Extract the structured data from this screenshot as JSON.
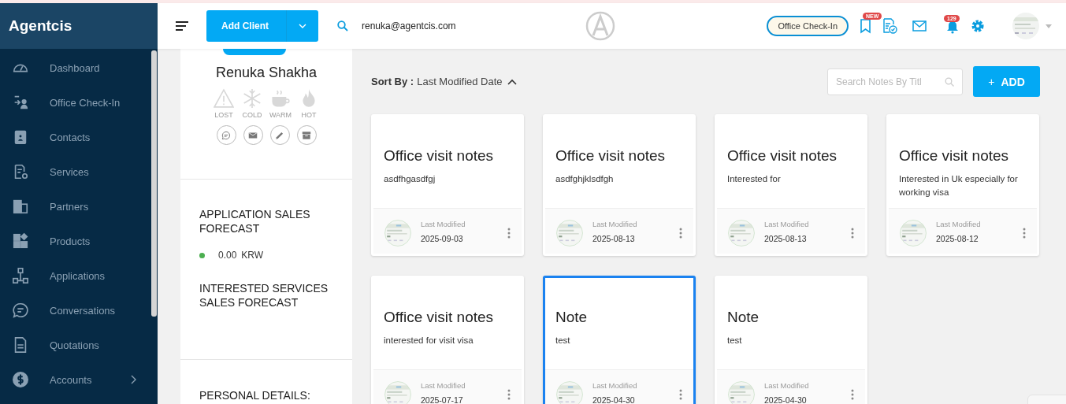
{
  "brand": "Agentcis",
  "sidebar": {
    "items": [
      {
        "label": "Dashboard",
        "kind": "gauge",
        "has_children": false
      },
      {
        "label": "Office Check-In",
        "kind": "checkin",
        "has_children": false
      },
      {
        "label": "Contacts",
        "kind": "badge",
        "has_children": false
      },
      {
        "label": "Services",
        "kind": "service",
        "has_children": false
      },
      {
        "label": "Partners",
        "kind": "building",
        "has_children": false
      },
      {
        "label": "Products",
        "kind": "blocks",
        "has_children": false
      },
      {
        "label": "Applications",
        "kind": "flow",
        "has_children": false
      },
      {
        "label": "Conversations",
        "kind": "chat",
        "has_children": false
      },
      {
        "label": "Quotations",
        "kind": "doc",
        "has_children": false
      },
      {
        "label": "Accounts",
        "kind": "dollar",
        "has_children": true
      }
    ]
  },
  "topbar": {
    "add_client": "Add Client",
    "user_email": "renuka@agentcis.com",
    "check_in": "Office Check-In",
    "new_badge": "NEW",
    "notification_count": "129"
  },
  "profile": {
    "name": "Renuka Shakha",
    "temperatures": [
      {
        "label": "LOST",
        "kind": "lost",
        "selected": false
      },
      {
        "label": "COLD",
        "kind": "cold",
        "selected": false
      },
      {
        "label": "WARM",
        "kind": "warm",
        "selected": false
      },
      {
        "label": "HOT",
        "kind": "hot",
        "selected": false
      }
    ],
    "actions": [
      {
        "kind": "chat"
      },
      {
        "kind": "mail"
      },
      {
        "kind": "edit"
      },
      {
        "kind": "archive"
      }
    ],
    "forecasts": [
      {
        "title": "APPLICATION SALES FORECAST",
        "amount": "0.00",
        "currency": "KRW",
        "color": "#4caf50"
      },
      {
        "title": "INTERESTED SERVICES SALES FORECAST"
      }
    ],
    "personal_title": "PERSONAL DETAILS:"
  },
  "notes": {
    "sort_label": "Sort By :",
    "sort_value": "Last Modified Date",
    "search_placeholder": "Search Notes By Titl",
    "add_icon": "+",
    "add_label": "ADD",
    "cards": [
      {
        "title": "Office visit notes",
        "body": "asdfhgasdfgj",
        "modified_label": "Last Modified",
        "date": "2025-09-03",
        "selected": false
      },
      {
        "title": "Office visit notes",
        "body": "asdfghjklsdfgh",
        "modified_label": "Last Modified",
        "date": "2025-08-13",
        "selected": false
      },
      {
        "title": "Office visit notes",
        "body": "Interested for",
        "modified_label": "Last Modified",
        "date": "2025-08-13",
        "selected": false
      },
      {
        "title": "Office visit notes",
        "body": "Interested in Uk especially for working visa",
        "modified_label": "Last Modified",
        "date": "2025-08-12",
        "selected": false
      },
      {
        "title": "Office visit notes",
        "body": "interested for visit visa",
        "modified_label": "Last Modified",
        "date": "2025-07-17",
        "selected": false
      },
      {
        "title": "Note",
        "body": "test",
        "modified_label": "Last Modified",
        "date": "2025-04-30",
        "selected": true
      },
      {
        "title": "Note",
        "body": "test",
        "modified_label": "Last Modified",
        "date": "2025-04-30",
        "selected": false
      }
    ]
  }
}
